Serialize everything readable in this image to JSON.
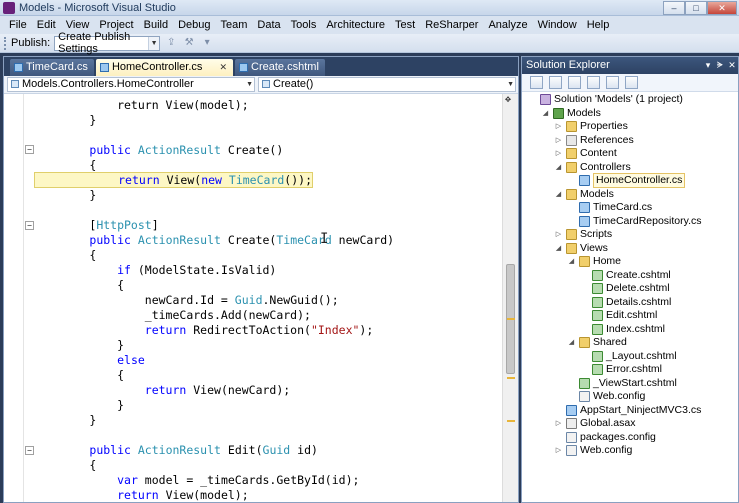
{
  "window": {
    "title": "Models - Microsoft Visual Studio",
    "buttons": {
      "minimize": "–",
      "maximize": "□",
      "close": "✕"
    }
  },
  "menu": [
    "File",
    "Edit",
    "View",
    "Project",
    "Build",
    "Debug",
    "Team",
    "Data",
    "Tools",
    "Architecture",
    "Test",
    "ReSharper",
    "Analyze",
    "Window",
    "Help"
  ],
  "toolbar": {
    "publish_label": "Publish:",
    "publish_value": "Create Publish Settings"
  },
  "editor": {
    "tabs": [
      {
        "label": "TimeCard.cs",
        "active": false
      },
      {
        "label": "HomeController.cs",
        "active": true
      },
      {
        "label": "Create.cshtml",
        "active": false
      }
    ],
    "class_combo": "Models.Controllers.HomeController",
    "member_combo": "Create()"
  },
  "code_lines": [
    "            return View(model);",
    "        }",
    "",
    "        public ActionResult Create()",
    "        {",
    "            return View(new TimeCard());",
    "        }",
    "",
    "        [HttpPost]",
    "        public ActionResult Create(TimeCard newCard)",
    "        {",
    "            if (ModelState.IsValid)",
    "            {",
    "                newCard.Id = Guid.NewGuid();",
    "                _timeCards.Add(newCard);",
    "                return RedirectToAction(\"Index\");",
    "            }",
    "            else",
    "            {",
    "                return View(newCard);",
    "            }",
    "        }",
    "",
    "        public ActionResult Edit(Guid id)",
    "        {",
    "            var model = _timeCards.GetById(id);",
    "            return View(model);"
  ],
  "solution_explorer": {
    "title": "Solution Explorer",
    "header_buttons": {
      "pin": "▾",
      "autohide": "ᗙ",
      "close": "✕"
    },
    "items": [
      {
        "label": "Solution 'Models' (1 project)",
        "icon": "solution-icon",
        "indent": 0,
        "expander": ""
      },
      {
        "label": "Models",
        "icon": "project-icon",
        "indent": 1,
        "expander": "◢"
      },
      {
        "label": "Properties",
        "icon": "folder-icon",
        "indent": 2,
        "expander": "▷"
      },
      {
        "label": "References",
        "icon": "references-icon",
        "indent": 2,
        "expander": "▷"
      },
      {
        "label": "Content",
        "icon": "folder-icon",
        "indent": 2,
        "expander": "▷"
      },
      {
        "label": "Controllers",
        "icon": "folder-icon",
        "indent": 2,
        "expander": "◢"
      },
      {
        "label": "HomeController.cs",
        "icon": "csharp-file-icon",
        "indent": 3,
        "expander": "",
        "selected": true
      },
      {
        "label": "Models",
        "icon": "folder-icon",
        "indent": 2,
        "expander": "◢"
      },
      {
        "label": "TimeCard.cs",
        "icon": "csharp-file-icon",
        "indent": 3,
        "expander": ""
      },
      {
        "label": "TimeCardRepository.cs",
        "icon": "csharp-file-icon",
        "indent": 3,
        "expander": ""
      },
      {
        "label": "Scripts",
        "icon": "folder-icon",
        "indent": 2,
        "expander": "▷"
      },
      {
        "label": "Views",
        "icon": "folder-icon",
        "indent": 2,
        "expander": "◢"
      },
      {
        "label": "Home",
        "icon": "folder-icon",
        "indent": 3,
        "expander": "◢"
      },
      {
        "label": "Create.cshtml",
        "icon": "cshtml-file-icon",
        "indent": 4,
        "expander": ""
      },
      {
        "label": "Delete.cshtml",
        "icon": "cshtml-file-icon",
        "indent": 4,
        "expander": ""
      },
      {
        "label": "Details.cshtml",
        "icon": "cshtml-file-icon",
        "indent": 4,
        "expander": ""
      },
      {
        "label": "Edit.cshtml",
        "icon": "cshtml-file-icon",
        "indent": 4,
        "expander": ""
      },
      {
        "label": "Index.cshtml",
        "icon": "cshtml-file-icon",
        "indent": 4,
        "expander": ""
      },
      {
        "label": "Shared",
        "icon": "folder-icon",
        "indent": 3,
        "expander": "◢"
      },
      {
        "label": "_Layout.cshtml",
        "icon": "cshtml-file-icon",
        "indent": 4,
        "expander": ""
      },
      {
        "label": "Error.cshtml",
        "icon": "cshtml-file-icon",
        "indent": 4,
        "expander": ""
      },
      {
        "label": "_ViewStart.cshtml",
        "icon": "cshtml-file-icon",
        "indent": 3,
        "expander": ""
      },
      {
        "label": "Web.config",
        "icon": "config-file-icon",
        "indent": 3,
        "expander": ""
      },
      {
        "label": "AppStart_NinjectMVC3.cs",
        "icon": "csharp-file-icon",
        "indent": 2,
        "expander": ""
      },
      {
        "label": "Global.asax",
        "icon": "asax-file-icon",
        "indent": 2,
        "expander": "▷"
      },
      {
        "label": "packages.config",
        "icon": "config-file-icon",
        "indent": 2,
        "expander": ""
      },
      {
        "label": "Web.config",
        "icon": "config-file-icon",
        "indent": 2,
        "expander": "▷"
      }
    ]
  },
  "colors": {
    "keyword": "#0000ff",
    "type": "#2b91af",
    "string": "#a31515",
    "highlight": "#fdf7c5",
    "frame": "#2b3c59"
  }
}
